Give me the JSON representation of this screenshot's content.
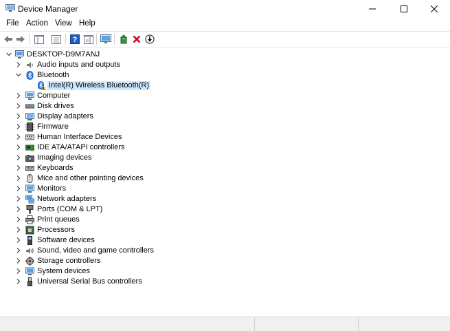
{
  "window": {
    "title": "Device Manager"
  },
  "menu": [
    "File",
    "Action",
    "View",
    "Help"
  ],
  "tree": {
    "root": "DESKTOP-D9M7ANJ",
    "items": [
      {
        "label": "Audio inputs and outputs",
        "icon": "speaker-icon",
        "expanded": false
      },
      {
        "label": "Bluetooth",
        "icon": "bluetooth-icon",
        "expanded": true,
        "children": [
          {
            "label": "Intel(R) Wireless Bluetooth(R)",
            "icon": "bluetooth-warning-icon",
            "selected": true
          }
        ]
      },
      {
        "label": "Computer",
        "icon": "computer-icon",
        "expanded": false
      },
      {
        "label": "Disk drives",
        "icon": "disk-drive-icon",
        "expanded": false
      },
      {
        "label": "Display adapters",
        "icon": "display-adapter-icon",
        "expanded": false
      },
      {
        "label": "Firmware",
        "icon": "firmware-icon",
        "expanded": false
      },
      {
        "label": "Human Interface Devices",
        "icon": "hid-icon",
        "expanded": false
      },
      {
        "label": "IDE ATA/ATAPI controllers",
        "icon": "ide-controller-icon",
        "expanded": false
      },
      {
        "label": "Imaging devices",
        "icon": "camera-icon",
        "expanded": false
      },
      {
        "label": "Keyboards",
        "icon": "keyboard-icon",
        "expanded": false
      },
      {
        "label": "Mice and other pointing devices",
        "icon": "mouse-icon",
        "expanded": false
      },
      {
        "label": "Monitors",
        "icon": "monitor-icon",
        "expanded": false
      },
      {
        "label": "Network adapters",
        "icon": "network-adapter-icon",
        "expanded": false
      },
      {
        "label": "Ports (COM & LPT)",
        "icon": "port-icon",
        "expanded": false
      },
      {
        "label": "Print queues",
        "icon": "printer-icon",
        "expanded": false
      },
      {
        "label": "Processors",
        "icon": "processor-icon",
        "expanded": false
      },
      {
        "label": "Software devices",
        "icon": "software-device-icon",
        "expanded": false
      },
      {
        "label": "Sound, video and game controllers",
        "icon": "sound-icon",
        "expanded": false
      },
      {
        "label": "Storage controllers",
        "icon": "storage-controller-icon",
        "expanded": false
      },
      {
        "label": "System devices",
        "icon": "system-device-icon",
        "expanded": false
      },
      {
        "label": "Universal Serial Bus controllers",
        "icon": "usb-icon",
        "expanded": false
      }
    ]
  },
  "colors": {
    "selection": "#cce8ff",
    "bluetooth": "#1e6fd9",
    "remove": "#d0021b",
    "add": "#2e8b3c"
  }
}
